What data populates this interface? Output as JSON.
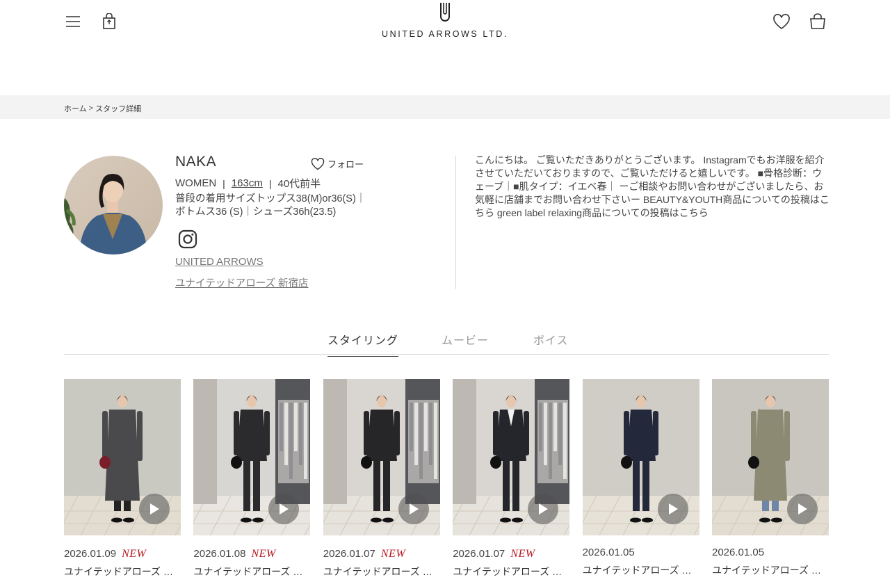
{
  "header": {
    "logo_text": "UNITED ARROWS LTD."
  },
  "breadcrumb": {
    "home": "ホーム",
    "separator": ">",
    "current": "スタッフ詳細"
  },
  "profile": {
    "name": "NAKA",
    "follow_label": "フォロー",
    "gender": "WOMEN",
    "height": "163cm",
    "age": "40代前半",
    "sizes_line1": "普段の着用サイズトップス38(M)or36(S)｜",
    "sizes_line2": "ボトムス36 (S)｜シューズ36h(23.5)",
    "brand": "UNITED ARROWS",
    "shop": "ユナイテッドアローズ 新宿店",
    "bio": "こんにちは。 ご覧いただきありがとうございます。 Instagramでもお洋服を紹介させていただいておりますので、ご覧いただけると嬉しいです。 ■骨格診断：ウェーブ｜■肌タイプ：イエベ春｜ ーご相談やお問い合わせがございましたら、お気軽に店舗までお問い合わせ下さいー BEAUTY&YOUTH商品についての投稿はこちら green label relaxing商品についての投稿はこちら"
  },
  "tabs": [
    {
      "label": "スタイリング",
      "active": true
    },
    {
      "label": "ムービー",
      "active": false
    },
    {
      "label": "ボイス",
      "active": false
    }
  ],
  "new_label": "NEW",
  "cards": [
    {
      "date": "2026.01.09",
      "is_new": true,
      "shop": "ユナイテッドアローズ 新宿店",
      "outfit": "charcoal long coat"
    },
    {
      "date": "2026.01.08",
      "is_new": true,
      "shop": "ユナイテッドアローズ 新宿店",
      "outfit": "black jacket, long skirt"
    },
    {
      "date": "2026.01.07",
      "is_new": true,
      "shop": "ユナイテッドアローズ 新宿店",
      "outfit": "black suit"
    },
    {
      "date": "2026.01.07",
      "is_new": true,
      "shop": "ユナイテッドアローズ 新宿店",
      "outfit": "black jacket, white tee"
    },
    {
      "date": "2026.01.05",
      "is_new": false,
      "shop": "ユナイテッドアローズ 新宿店",
      "outfit": "navy double jacket"
    },
    {
      "date": "2026.01.05",
      "is_new": false,
      "shop": "ユナイテッドアローズ 新宿店",
      "outfit": "khaki trench, denim"
    }
  ],
  "icons": {
    "menu": "hamburger-menu-icon",
    "shop_bag": "shopping-bag-icon",
    "favorite": "heart-icon",
    "cart": "cart-bag-icon",
    "instagram": "instagram-icon",
    "play": "play-icon"
  },
  "colors": {
    "new_badge": "#b8141e",
    "breadcrumb_bg": "#f3f3f3",
    "link": "#777777"
  }
}
